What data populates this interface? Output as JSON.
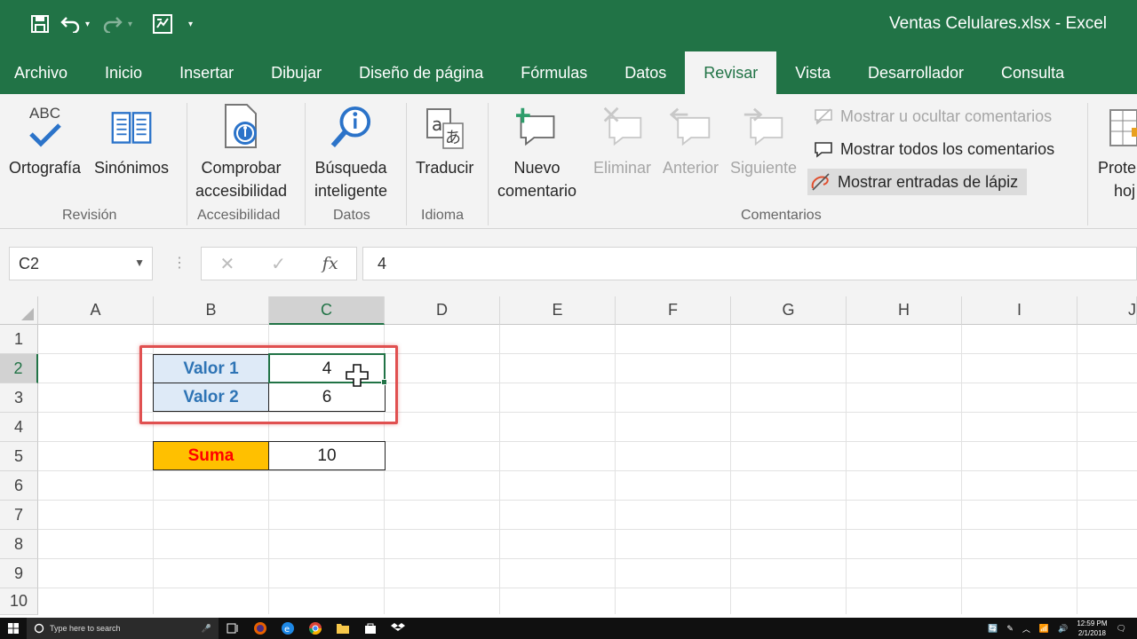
{
  "window": {
    "title": "Ventas Celulares.xlsx  -  Excel"
  },
  "tabs": [
    "Archivo",
    "Inicio",
    "Insertar",
    "Dibujar",
    "Diseño de página",
    "Fórmulas",
    "Datos",
    "Revisar",
    "Vista",
    "Desarrollador",
    "Consulta"
  ],
  "active_tab": "Revisar",
  "ribbon": {
    "ortografia": {
      "icon_text": "ABC",
      "label": "Ortografía"
    },
    "sinonimos": "Sinónimos",
    "accesibilidad": {
      "line1": "Comprobar",
      "line2": "accesibilidad"
    },
    "busqueda": {
      "line1": "Búsqueda",
      "line2": "inteligente"
    },
    "traducir": "Traducir",
    "nuevo_comentario": {
      "line1": "Nuevo",
      "line2": "comentario"
    },
    "eliminar": "Eliminar",
    "anterior": "Anterior",
    "siguiente": "Siguiente",
    "mostrar_ocultar": "Mostrar u ocultar comentarios",
    "mostrar_todos": "Mostrar todos los comentarios",
    "mostrar_lapiz": "Mostrar entradas de lápiz",
    "proteger": {
      "line1": "Prote",
      "line2": "hoj"
    },
    "groups": {
      "revision": "Revisión",
      "accesibilidad": "Accesibilidad",
      "datos": "Datos",
      "idioma": "Idioma",
      "comentarios": "Comentarios"
    }
  },
  "formula_bar": {
    "name_box": "C2",
    "formula": "4",
    "fx": "fx"
  },
  "columns": [
    "A",
    "B",
    "C",
    "D",
    "E",
    "F",
    "G",
    "H",
    "I",
    "J"
  ],
  "selected_column": "C",
  "rows": [
    "1",
    "2",
    "3",
    "4",
    "5",
    "6",
    "7",
    "8",
    "9",
    "10"
  ],
  "selected_row": "2",
  "cells": {
    "B2": "Valor 1",
    "C2": "4",
    "B3": "Valor 2",
    "C3": "6",
    "B5": "Suma",
    "C5": "10"
  },
  "colors": {
    "excel_green": "#217346",
    "label_fill": "#deeaf7",
    "label_text": "#2e74b5",
    "sum_fill": "#ffc000",
    "sum_text": "#ff0000",
    "highlight_frame": "#e05050"
  },
  "taskbar": {
    "search_placeholder": "Type here to search",
    "time": "12:59 PM",
    "date": "2/1/2018"
  }
}
